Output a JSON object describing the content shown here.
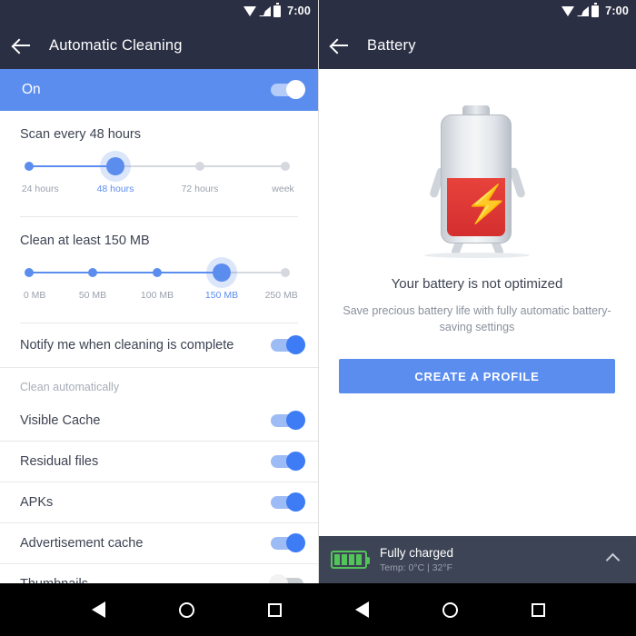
{
  "status_bar": {
    "time": "7:00",
    "icons": [
      "wifi-icon",
      "signal-icon",
      "battery-icon"
    ]
  },
  "left_pane": {
    "title": "Automatic Cleaning",
    "back_icon": "back-arrow-icon",
    "master_toggle": {
      "label": "On",
      "state": "on"
    },
    "scan_section": {
      "title": "Scan every 48 hours",
      "labels": [
        "24 hours",
        "48 hours",
        "72 hours",
        "week"
      ],
      "active_index": 1
    },
    "clean_section": {
      "title": "Clean at least 150 MB",
      "labels": [
        "0 MB",
        "50 MB",
        "100 MB",
        "150 MB",
        "250 MB"
      ],
      "active_index": 3
    },
    "notify_row": {
      "label": "Notify me when cleaning is complete",
      "state": "on"
    },
    "group_header": "Clean automatically",
    "auto_rows": [
      {
        "label": "Visible Cache",
        "state": "on"
      },
      {
        "label": "Residual files",
        "state": "on"
      },
      {
        "label": "APKs",
        "state": "on"
      },
      {
        "label": "Advertisement cache",
        "state": "on"
      },
      {
        "label": "Thumbnails",
        "state": "off"
      }
    ]
  },
  "right_pane": {
    "title": "Battery",
    "back_icon": "back-arrow-icon",
    "illustration": "battery-character-icon",
    "headline": "Your battery is not optimized",
    "subtext": "Save precious battery life with fully automatic battery-saving settings",
    "cta_label": "CREATE A PROFILE",
    "status_bar_bottom": {
      "icon": "battery-full-icon",
      "title": "Fully charged",
      "subtitle": "Temp: 0°C | 32°F",
      "expand_icon": "chevron-up-icon"
    }
  },
  "nav_bar": {
    "buttons": [
      "back-triangle-icon",
      "home-circle-icon",
      "recents-square-icon"
    ]
  },
  "colors": {
    "appbar": "#2b2f43",
    "accent": "#5b8def",
    "battery_red": "#d32f2f",
    "battery_green": "#52c45a"
  }
}
